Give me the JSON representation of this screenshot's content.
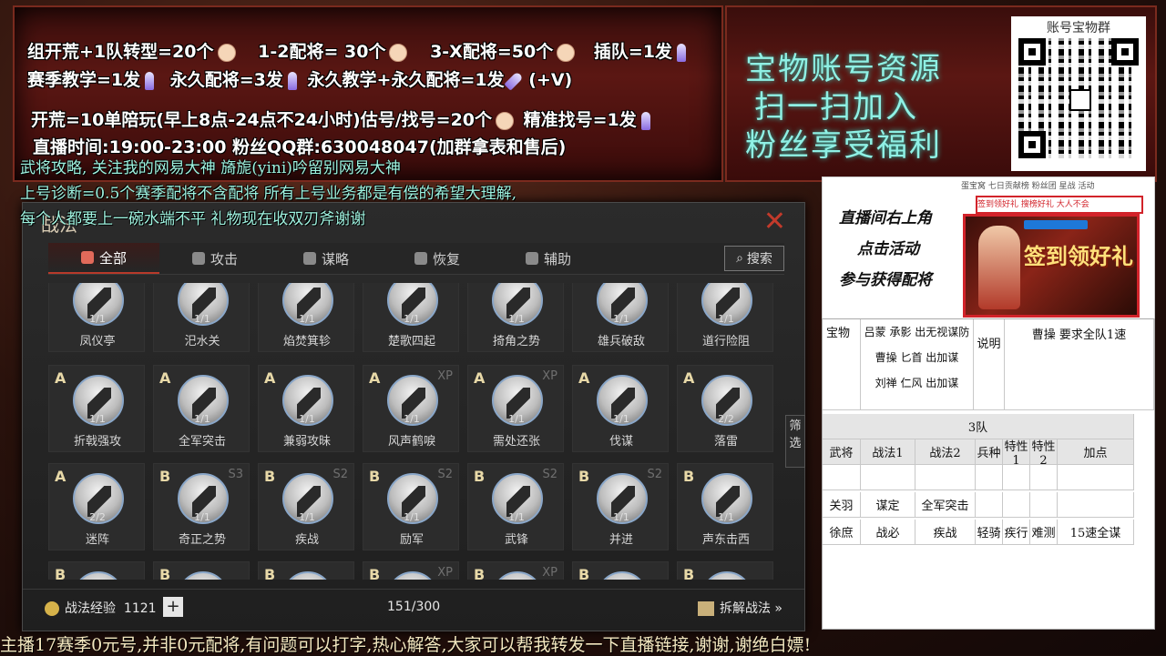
{
  "promo": {
    "line1": [
      "组开荒+1队转型=20个",
      "1-2配将= 30个",
      "3-X配将=50个",
      "插队=1发"
    ],
    "line2": [
      "赛季教学=1发",
      "永久配将=3发",
      "永久教学+永久配将=1发",
      "(+V)"
    ],
    "line3": [
      "开荒=10单陪玩(早上8点-24点不24小时)估号/找号=20个",
      "精准找号=1发"
    ],
    "line4": "直播时间:19:00-23:00  粉丝QQ群:630048047(加群拿表和售后)"
  },
  "right_banner": {
    "line1": "宝物账号资源",
    "line2": "扫一扫加入",
    "line3": "粉丝享受福利",
    "qr_title": "账号宝物群"
  },
  "overlay": {
    "line1": "武将攻略, 关注我的网易大神 旖旎(yini)吟留别网易大神",
    "line2": "上号诊断=0.5个赛季配将不含配将 所有上号业务都是有偿的希望大理解,",
    "line3": "每个人都要上一碗水端不平 礼物现在收双刃斧谢谢"
  },
  "panel": {
    "title": "战法",
    "tabs": [
      "全部",
      "攻击",
      "谋略",
      "恢复",
      "辅助"
    ],
    "tab_icons": [
      "all-icon",
      "sword-icon",
      "scheme-icon",
      "heal-icon",
      "support-icon"
    ],
    "search_label": "搜索",
    "rows": [
      [
        {
          "grade": "",
          "tag": "",
          "count": "1/1",
          "name": "凤仪亭"
        },
        {
          "grade": "",
          "tag": "",
          "count": "1/1",
          "name": "汜水关"
        },
        {
          "grade": "",
          "tag": "",
          "count": "1/1",
          "name": "焰焚箕轸"
        },
        {
          "grade": "",
          "tag": "",
          "count": "1/1",
          "name": "楚歌四起"
        },
        {
          "grade": "",
          "tag": "",
          "count": "1/1",
          "name": "掎角之势"
        },
        {
          "grade": "",
          "tag": "",
          "count": "1/1",
          "name": "雄兵破敌"
        },
        {
          "grade": "",
          "tag": "",
          "count": "1/1",
          "name": "道行险阻"
        }
      ],
      [
        {
          "grade": "A",
          "tag": "",
          "count": "1/1",
          "name": "折戟强攻"
        },
        {
          "grade": "A",
          "tag": "",
          "count": "1/1",
          "name": "全军突击"
        },
        {
          "grade": "A",
          "tag": "",
          "count": "1/1",
          "name": "兼弱攻昧"
        },
        {
          "grade": "A",
          "tag": "XP",
          "count": "1/1",
          "name": "风声鹤唳"
        },
        {
          "grade": "A",
          "tag": "XP",
          "count": "1/1",
          "name": "需处还张"
        },
        {
          "grade": "A",
          "tag": "",
          "count": "1/1",
          "name": "伐谋"
        },
        {
          "grade": "A",
          "tag": "",
          "count": "2/2",
          "name": "落雷"
        }
      ],
      [
        {
          "grade": "A",
          "tag": "",
          "count": "2/2",
          "name": "迷阵"
        },
        {
          "grade": "B",
          "tag": "S3",
          "count": "1/1",
          "name": "奇正之势"
        },
        {
          "grade": "B",
          "tag": "S2",
          "count": "1/1",
          "name": "疾战"
        },
        {
          "grade": "B",
          "tag": "S2",
          "count": "1/1",
          "name": "励军"
        },
        {
          "grade": "B",
          "tag": "S2",
          "count": "1/1",
          "name": "武锋"
        },
        {
          "grade": "B",
          "tag": "S2",
          "count": "1/1",
          "name": "并进"
        },
        {
          "grade": "B",
          "tag": "",
          "count": "1/1",
          "name": "声东击西"
        }
      ],
      [
        {
          "grade": "B",
          "tag": "",
          "count": "",
          "name": ""
        },
        {
          "grade": "B",
          "tag": "",
          "count": "",
          "name": ""
        },
        {
          "grade": "B",
          "tag": "",
          "count": "",
          "name": ""
        },
        {
          "grade": "B",
          "tag": "XP",
          "count": "",
          "name": ""
        },
        {
          "grade": "B",
          "tag": "XP",
          "count": "",
          "name": ""
        },
        {
          "grade": "B",
          "tag": "",
          "count": "",
          "name": ""
        },
        {
          "grade": "B",
          "tag": "",
          "count": "",
          "name": ""
        }
      ]
    ],
    "exp_label": "战法经验",
    "exp_value": "1121",
    "plus_label": "+",
    "page": "151/300",
    "decompose_label": "拆解战法 »",
    "filter_label": "筛选"
  },
  "ad": {
    "text1": "直播间右上角",
    "text2": "点击活动",
    "text3": "参与获得配将",
    "topbar": "蛋宝窝  七日贡献榜  粉丝团  星战  活动",
    "tabs": "签到领好礼  搜榜好礼  大人不会",
    "banner": "签到领好礼"
  },
  "sheet": {
    "rows_top": [
      [
        "宝物",
        "吕蒙 承影 出无视谋防\n曹操 匕首 出加谋\n刘禅 仁风 出加谋",
        "说明",
        "曹操 要求全队1速"
      ]
    ],
    "section": "3队",
    "headers": [
      "武将",
      "战法1",
      "战法2",
      "兵种",
      "特性1",
      "特性2",
      "加点"
    ],
    "rows": [
      [
        "",
        "",
        "",
        "",
        "",
        "",
        ""
      ],
      [
        "关羽",
        "谋定",
        "全军突击",
        "",
        "",
        "",
        ""
      ],
      [
        "徐庶",
        "战必",
        "疾战",
        "轻骑",
        "疾行",
        "难测",
        "15速全谋"
      ]
    ]
  },
  "ticker": "主播17赛季0元号,并非0元配将,有问题可以打字,热心解答,大家可以帮我转发一下直播链接,谢谢,谢绝白嫖!"
}
